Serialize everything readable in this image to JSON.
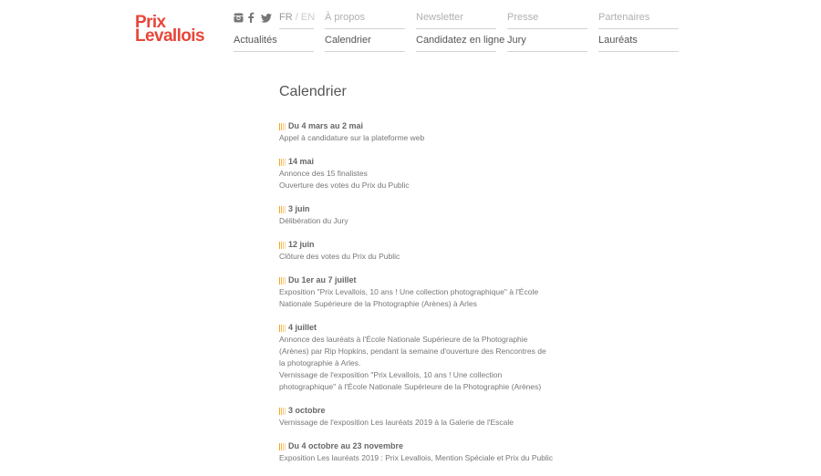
{
  "logo": {
    "line1": "Prix",
    "line2": "Levallois"
  },
  "social": {
    "icons": [
      "instagram-icon",
      "facebook-icon",
      "twitter-icon"
    ],
    "color": "#888888"
  },
  "lang": {
    "fr": "FR",
    "sep": "/",
    "en": "EN"
  },
  "nav": {
    "top": [
      "À propos",
      "Newsletter",
      "Presse",
      "Partenaires"
    ],
    "bottom": [
      "Actualités",
      "Calendrier",
      "Candidatez en ligne",
      "Jury",
      "Lauréats"
    ]
  },
  "page": {
    "title": "Calendrier"
  },
  "events": [
    {
      "date": "Du 4 mars au 2 mai",
      "lines": [
        "Appel à candidature sur la plateforme web"
      ]
    },
    {
      "date": "14 mai",
      "lines": [
        "Annonce des 15 finalistes",
        "Ouverture des votes du Prix du Public"
      ]
    },
    {
      "date": "3 juin",
      "lines": [
        "Délibération du Jury"
      ]
    },
    {
      "date": "12 juin",
      "lines": [
        "Clôture des votes du Prix du Public"
      ]
    },
    {
      "date": "Du 1er au 7 juillet",
      "lines": [
        "Exposition \"Prix Levallois, 10 ans ! Une collection photographique\" à l'École",
        "Nationale Supérieure de la Photographie (Arènes) à Arles"
      ]
    },
    {
      "date": "4 juillet",
      "lines": [
        "Annonce des lauréats à l'École Nationale Supérieure de la Photographie",
        "(Arènes) par Rip Hopkins, pendant la semaine d'ouverture des Rencontres de",
        "la photographie à Arles.",
        "Vernissage de l'exposition \"Prix Levallois, 10 ans ! Une collection",
        "photographique\" à l'École Nationale Supérieure de la Photographie (Arènes)"
      ]
    },
    {
      "date": "3 octobre",
      "lines": [
        "Vernissage de l'exposition Les lauréats 2019 à la Galerie de l'Escale"
      ]
    },
    {
      "date": "Du 4 octobre au 23 novembre",
      "lines": [
        "Exposition Les lauréats 2019 : Prix Levallois, Mention Spéciale et Prix du Public"
      ]
    }
  ],
  "colors": {
    "brand": "#e8463a",
    "accent": "#f5a623",
    "text": "#666666"
  }
}
